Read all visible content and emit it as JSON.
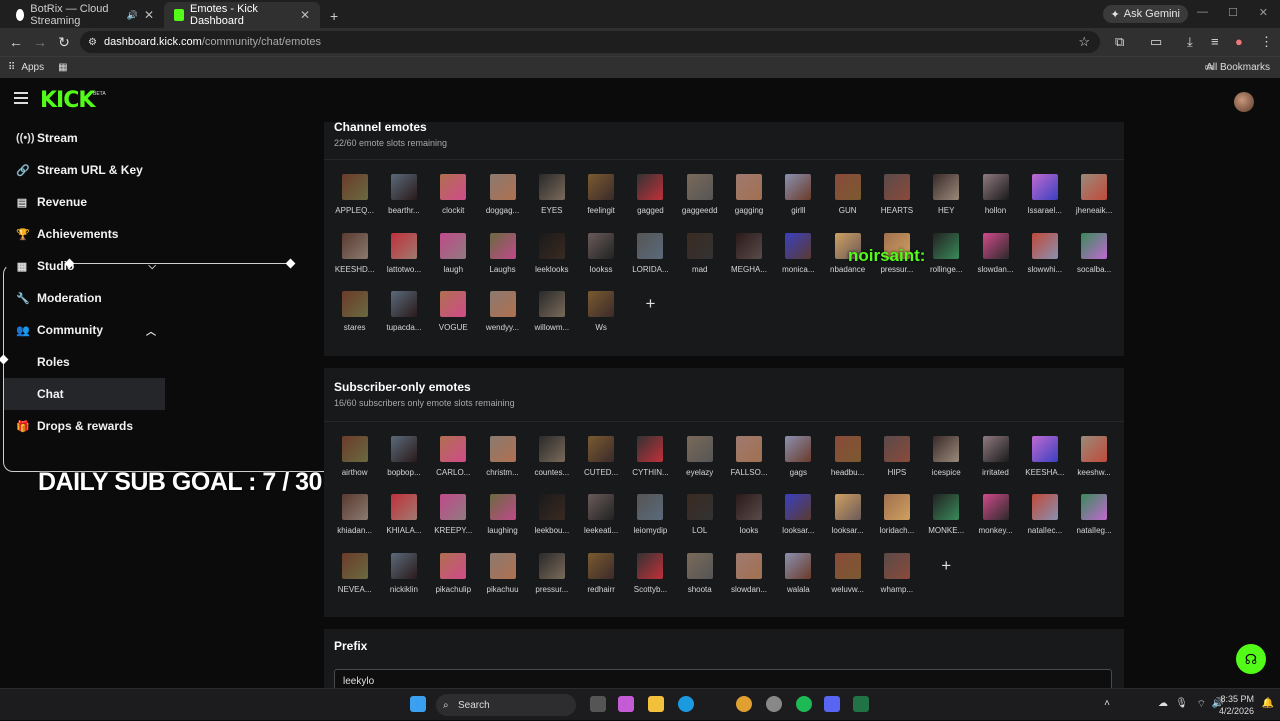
{
  "browser": {
    "tabs": [
      {
        "title": "BotRix — Cloud Streaming",
        "active": false
      },
      {
        "title": "Emotes - Kick Dashboard",
        "active": true
      }
    ],
    "ask_gemini": "Ask Gemini",
    "url_host": "dashboard.kick.com",
    "url_path": "/community/chat/emotes",
    "bookmark_apps": "Apps",
    "bookmark_all": "All Bookmarks"
  },
  "header": {
    "logo": "KICK",
    "logo_beta": "BETA"
  },
  "sidebar": {
    "items": [
      {
        "label": "Stream",
        "icon": "broadcast-icon"
      },
      {
        "label": "Stream URL & Key",
        "icon": "link-icon"
      },
      {
        "label": "Revenue",
        "icon": "chart-icon"
      },
      {
        "label": "Achievements",
        "icon": "trophy-icon"
      },
      {
        "label": "Studio",
        "icon": "grid-icon"
      },
      {
        "label": "Moderation",
        "icon": "wrench-icon"
      },
      {
        "label": "Community",
        "icon": "people-icon"
      },
      {
        "label": "Roles",
        "icon": ""
      },
      {
        "label": "Chat",
        "icon": ""
      },
      {
        "label": "Drops & rewards",
        "icon": "gift-icon"
      }
    ]
  },
  "overlay": {
    "daily_goal": "DAILY SUB GOAL : 7 / 30",
    "kick_tag": "noirsaint:"
  },
  "channel_emotes": {
    "title": "Channel emotes",
    "subtitle": "22/60 emote slots remaining",
    "emotes": [
      "APPLEQ...",
      "bearthr...",
      "clockit",
      "doggag...",
      "EYES",
      "feelingit",
      "gagged",
      "gaggeedd",
      "gagging",
      "girlll",
      "GUN",
      "HEARTS",
      "HEY",
      "hollon",
      "lssarael...",
      "jheneaik...",
      "KEESHD...",
      "lattotwo...",
      "laugh",
      "Laughs",
      "leeklooks",
      "lookss",
      "LORIDA...",
      "mad",
      "MEGHA...",
      "monica...",
      "nbadance",
      "pressur...",
      "rollinge...",
      "slowdan...",
      "slowwhi...",
      "socalba...",
      "stares",
      "tupacda...",
      "VOGUE",
      "wendyy...",
      "willowm...",
      "Ws"
    ]
  },
  "subscriber_emotes": {
    "title": "Subscriber-only emotes",
    "subtitle": "16/60 subscribers only emote slots remaining",
    "emotes": [
      "airthow",
      "bopbop...",
      "CARLO...",
      "christm...",
      "countes...",
      "CUTED...",
      "CYTHIN...",
      "eyelazy",
      "FALLSO...",
      "gags",
      "headbu...",
      "HIPS",
      "icespice",
      "irritated",
      "KEESHA...",
      "keeshw...",
      "khiadan...",
      "KHIALA...",
      "KREEPY...",
      "laughing",
      "leekbou...",
      "leekeati...",
      "leiomydip",
      "LOL",
      "looks",
      "looksar...",
      "looksar...",
      "loridach...",
      "MONKE...",
      "monkey...",
      "natalIec...",
      "natalIeg...",
      "NEVEA...",
      "nickiklin",
      "pikachulip",
      "pikachuu",
      "pressur...",
      "redhairr",
      "Scottyb...",
      "shoota",
      "slowdan...",
      "walala",
      "weluvw...",
      "whamp..."
    ]
  },
  "prefix": {
    "title": "Prefix",
    "value": "leekylo"
  },
  "taskbar": {
    "search": "Search",
    "time": "8:35 PM",
    "date": "4/2/2026"
  },
  "colors": {
    "kick_green": "#53fc18",
    "panel": "#17191b",
    "background": "#0b0b0c"
  }
}
